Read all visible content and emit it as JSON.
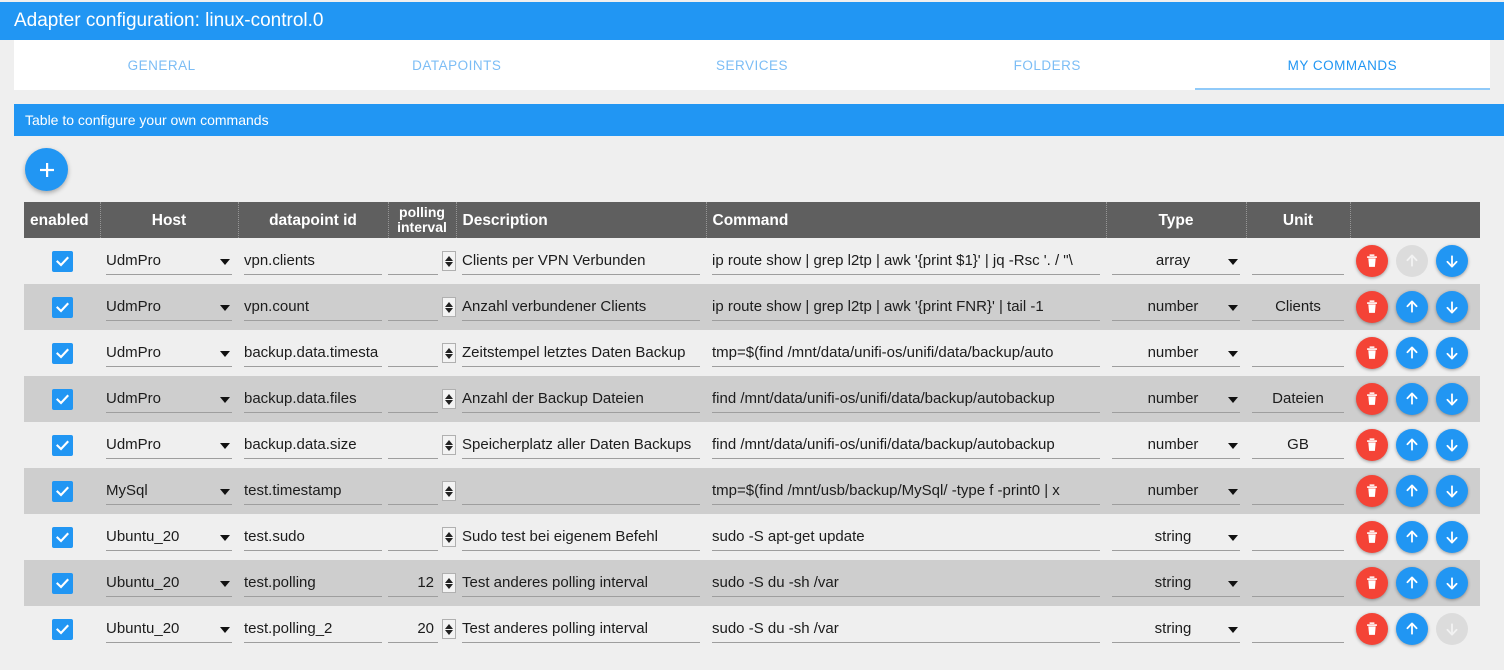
{
  "window": {
    "title": "Adapter configuration: linux-control.0",
    "accent_color": "#2196f3",
    "header_bg": "#5f5f5f",
    "delete_color": "#f44336"
  },
  "tabs": [
    {
      "label": "GENERAL",
      "active": false
    },
    {
      "label": "DATAPOINTS",
      "active": false
    },
    {
      "label": "SERVICES",
      "active": false
    },
    {
      "label": "FOLDERS",
      "active": false
    },
    {
      "label": "MY COMMANDS",
      "active": true
    }
  ],
  "banner": {
    "text": "Table to configure your own commands"
  },
  "toolbar": {
    "add_label": "+",
    "add_icon": "plus-icon"
  },
  "table": {
    "columns": [
      {
        "key": "enabled",
        "label": "enabled"
      },
      {
        "key": "host",
        "label": "Host"
      },
      {
        "key": "datapoint",
        "label": "datapoint id"
      },
      {
        "key": "polling",
        "label": "polling interval"
      },
      {
        "key": "description",
        "label": "Description"
      },
      {
        "key": "command",
        "label": "Command"
      },
      {
        "key": "type",
        "label": "Type"
      },
      {
        "key": "unit",
        "label": "Unit"
      },
      {
        "key": "actions",
        "label": ""
      }
    ],
    "rows": [
      {
        "enabled": true,
        "host": "UdmPro",
        "datapoint": "vpn.clients",
        "polling": "",
        "description": "Clients per VPN Verbunden",
        "command": "ip route show | grep l2tp | awk '{print $1}' | jq -Rsc '. / \"\\",
        "type": "array",
        "unit": "",
        "up_enabled": false,
        "down_enabled": true
      },
      {
        "enabled": true,
        "host": "UdmPro",
        "datapoint": "vpn.count",
        "polling": "",
        "description": "Anzahl verbundener Clients",
        "command": "ip route show | grep l2tp | awk '{print FNR}' | tail -1",
        "type": "number",
        "unit": "Clients",
        "up_enabled": true,
        "down_enabled": true
      },
      {
        "enabled": true,
        "host": "UdmPro",
        "datapoint": "backup.data.timesta",
        "polling": "",
        "description": "Zeitstempel letztes Daten Backup",
        "command": "tmp=$(find /mnt/data/unifi-os/unifi/data/backup/auto",
        "type": "number",
        "unit": "",
        "up_enabled": true,
        "down_enabled": true
      },
      {
        "enabled": true,
        "host": "UdmPro",
        "datapoint": "backup.data.files",
        "polling": "",
        "description": "Anzahl der Backup Dateien",
        "command": "find /mnt/data/unifi-os/unifi/data/backup/autobackup",
        "type": "number",
        "unit": "Dateien",
        "up_enabled": true,
        "down_enabled": true
      },
      {
        "enabled": true,
        "host": "UdmPro",
        "datapoint": "backup.data.size",
        "polling": "",
        "description": "Speicherplatz aller Daten Backups",
        "command": "find /mnt/data/unifi-os/unifi/data/backup/autobackup",
        "type": "number",
        "unit": "GB",
        "up_enabled": true,
        "down_enabled": true
      },
      {
        "enabled": true,
        "host": "MySql",
        "datapoint": "test.timestamp",
        "polling": "",
        "description": "",
        "command": "tmp=$(find /mnt/usb/backup/MySql/ -type f -print0 | x",
        "type": "number",
        "unit": "",
        "up_enabled": true,
        "down_enabled": true
      },
      {
        "enabled": true,
        "host": "Ubuntu_20",
        "datapoint": "test.sudo",
        "polling": "",
        "description": "Sudo test bei eigenem Befehl",
        "command": "sudo -S apt-get update",
        "type": "string",
        "unit": "",
        "up_enabled": true,
        "down_enabled": true
      },
      {
        "enabled": true,
        "host": "Ubuntu_20",
        "datapoint": "test.polling",
        "polling": "12",
        "description": "Test anderes polling interval",
        "command": "sudo -S du -sh /var",
        "type": "string",
        "unit": "",
        "up_enabled": true,
        "down_enabled": true
      },
      {
        "enabled": true,
        "host": "Ubuntu_20",
        "datapoint": "test.polling_2",
        "polling": "20",
        "description": "Test anderes polling interval",
        "command": "sudo -S du -sh /var",
        "type": "string",
        "unit": "",
        "up_enabled": true,
        "down_enabled": false
      }
    ]
  },
  "icons": {
    "delete": "trash-icon",
    "move_up": "arrow-up-icon",
    "move_down": "arrow-down-icon",
    "dropdown": "chevron-down-icon",
    "checked": "check-icon"
  }
}
